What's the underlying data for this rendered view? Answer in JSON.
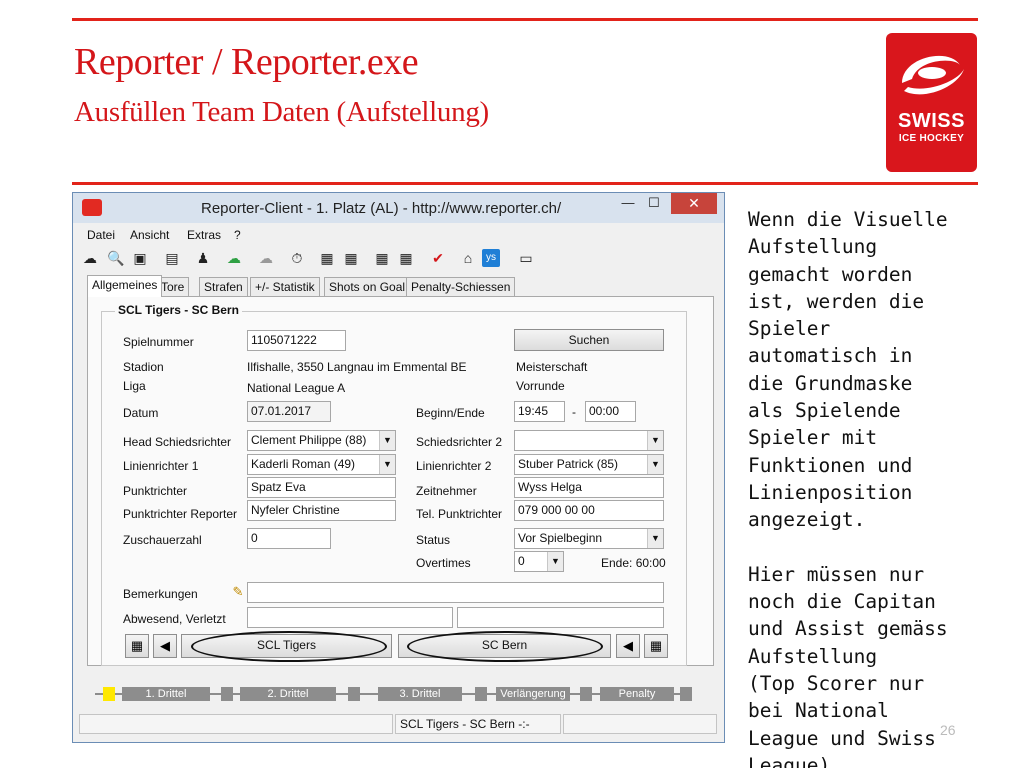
{
  "slide": {
    "title": "Reporter / Reporter.exe",
    "subtitle": "Ausfüllen Team Daten (Aufstellung)",
    "logo_line1": "SWISS",
    "logo_line2": "ICE HOCKEY",
    "side_text": "Wenn die Visuelle\nAufstellung\ngemacht worden\nist, werden die\nSpieler\nautomatisch in\ndie Grundmaske\nals Spielende\nSpieler mit\nFunktionen und\nLinienposition\nangezeigt.\n\nHier müssen nur\nnoch die Capitan\nund Assist gemäss\nAufstellung\n(Top Scorer nur\nbei National\nLeague und Swiss\nLeague)",
    "page_number": "26",
    "accent_color": "#e2231a"
  },
  "window": {
    "title": "Reporter-Client  -  1. Platz (AL)  -  http://www.reporter.ch/",
    "minimize": "—",
    "maximize": "☐",
    "close": "✕"
  },
  "menu": [
    "Datei",
    "Ansicht",
    "Extras",
    "?"
  ],
  "toolbar_icons": [
    "cloud-download-icon",
    "search-icon",
    "save-icon",
    "clipboard-icon",
    "players-icon",
    "cloud-upload-icon",
    "cloud-icon",
    "stopwatch-icon",
    "lineup-home-icon",
    "lineup-away-icon",
    "shots-home-icon",
    "shots-away-icon",
    "check-icon",
    "home-icon",
    "info-icon",
    "tv-icon"
  ],
  "tabs": [
    "Allgemeines",
    "Tore",
    "Strafen",
    "+/- Statistik",
    "Shots on Goal",
    "Penalty-Schiessen"
  ],
  "group_title": "SCL Tigers - SC Bern",
  "form": {
    "spielnummer_label": "Spielnummer",
    "spielnummer": "1105071222",
    "suchen": "Suchen",
    "stadion_label": "Stadion",
    "stadion": "Ilfishalle, 3550 Langnau im Emmental BE",
    "wettbewerb": "Meisterschaft",
    "liga_label": "Liga",
    "liga": "National League A",
    "phase": "Vorrunde",
    "datum_label": "Datum",
    "datum": "07.01.2017",
    "beginn_label": "Beginn/Ende",
    "beginn": "19:45",
    "dash": "-",
    "ende": "00:00",
    "head_sr_label": "Head Schiedsrichter",
    "head_sr": "Clement Philippe (88)",
    "sr2_label": "Schiedsrichter 2",
    "sr2": "",
    "lr1_label": "Linienrichter  1",
    "lr1": "Kaderli Roman (49)",
    "lr2_label": "Linienrichter 2",
    "lr2": "Stuber Patrick (85)",
    "punktrichter_label": "Punktrichter",
    "punktrichter": "Spatz Eva",
    "zeitnehmer_label": "Zeitnehmer",
    "zeitnehmer": "Wyss Helga",
    "pr_reporter_label": "Punktrichter Reporter",
    "pr_reporter": "Nyfeler Christine",
    "tel_label": "Tel. Punktrichter",
    "tel": "079 000 00 00",
    "zuschauer_label": "Zuschauerzahl",
    "zuschauer": "0",
    "status_label": "Status",
    "status": "Vor Spielbeginn",
    "overtimes_label": "Overtimes",
    "overtimes": "0",
    "ende_info": "Ende: 60:00",
    "bemerkungen_label": "Bemerkungen",
    "bemerkungen": "",
    "abwesend_label": "Abwesend, Verletzt",
    "abwesend_home": "",
    "abwesend_away": ""
  },
  "teams": {
    "home": "SCL Tigers",
    "away": "SC Bern"
  },
  "timeline": [
    "1. Drittel",
    "2. Drittel",
    "3. Drittel",
    "Verlängerung",
    "Penalty"
  ],
  "statusbar": {
    "game": "SCL Tigers - SC Bern -:-"
  }
}
